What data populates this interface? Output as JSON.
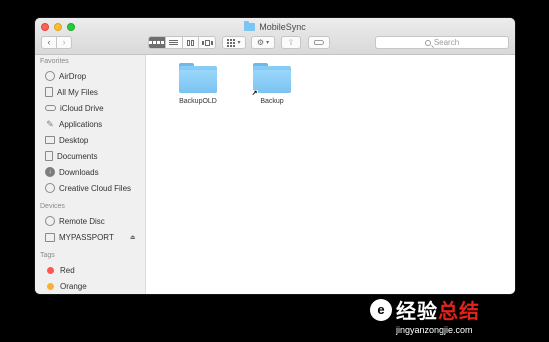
{
  "window": {
    "title": "MobileSync"
  },
  "toolbar": {
    "back_icon": "‹",
    "forward_icon": "›",
    "action_icon": "⚙",
    "share_icon": "⇪",
    "dropdown_icon": "▾",
    "search_placeholder": "Search"
  },
  "sidebar": {
    "sections": [
      {
        "label": "Favorites"
      },
      {
        "label": "Devices"
      },
      {
        "label": "Tags"
      }
    ],
    "favorites": [
      {
        "label": "AirDrop",
        "icon": "airdrop-icon"
      },
      {
        "label": "All My Files",
        "icon": "all-files-icon"
      },
      {
        "label": "iCloud Drive",
        "icon": "cloud-icon"
      },
      {
        "label": "Applications",
        "icon": "applications-icon"
      },
      {
        "label": "Desktop",
        "icon": "desktop-icon"
      },
      {
        "label": "Documents",
        "icon": "documents-icon"
      },
      {
        "label": "Downloads",
        "icon": "downloads-icon"
      },
      {
        "label": "Creative Cloud Files",
        "icon": "creative-cloud-icon"
      }
    ],
    "devices": [
      {
        "label": "Remote Disc",
        "icon": "disc-icon"
      },
      {
        "label": "MYPASSPORT",
        "icon": "drive-icon",
        "eject": "⏏"
      }
    ],
    "tags": [
      {
        "label": "Red",
        "color": "#fc5753"
      },
      {
        "label": "Orange",
        "color": "#fdad3a"
      }
    ]
  },
  "files": [
    {
      "name": "BackupOLD",
      "alias": false
    },
    {
      "name": "Backup",
      "alias": true,
      "alias_glyph": "↗"
    }
  ],
  "watermark": {
    "logo_text": "e",
    "text_main": "经验",
    "text_accent": "总结",
    "url": "jingyanzongjie.com"
  }
}
